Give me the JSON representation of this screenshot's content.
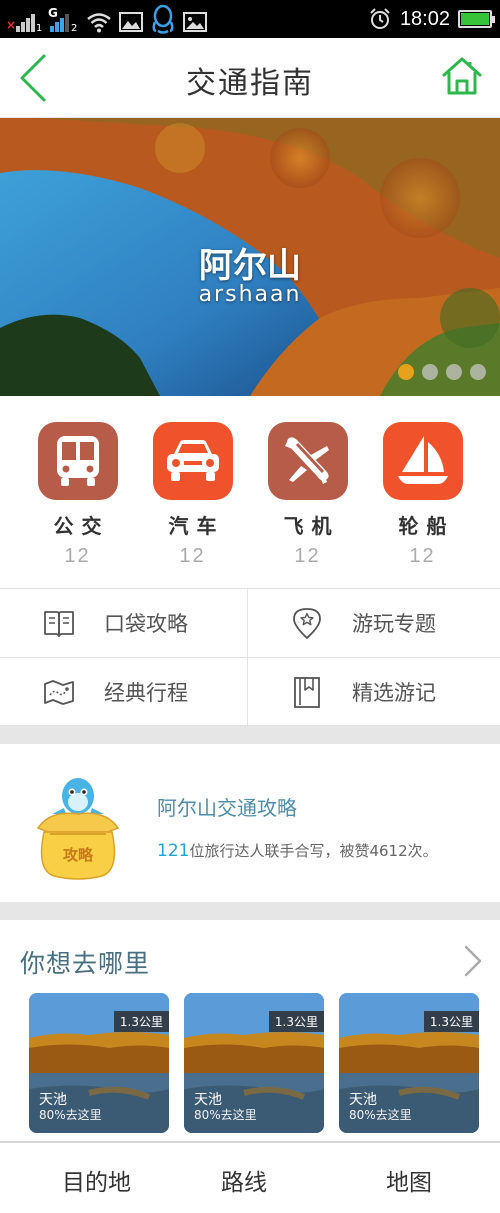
{
  "status_bar": {
    "sim1_label": "1",
    "sim1_mark": "×",
    "sim2_network": "G",
    "sim2_label": "2",
    "time": "18:02",
    "battery_level": 1.0,
    "icons": [
      "signal-icon",
      "wifi-icon",
      "image-icon",
      "qq-icon",
      "gallery-icon",
      "alarm-icon",
      "battery-icon"
    ]
  },
  "header": {
    "title": "交通指南",
    "back_icon": "back-chevron-icon",
    "home_icon": "home-icon",
    "accent_color": "#2db84d"
  },
  "banner": {
    "title": "阿尔山",
    "subtitle": "arshaan",
    "pages": 4,
    "active_page": 1,
    "active_dot_color": "#e7a21c"
  },
  "transport": [
    {
      "label": "公交",
      "count": "12",
      "icon": "bus-icon",
      "color": "#b85c4a"
    },
    {
      "label": "汽车",
      "count": "12",
      "icon": "car-icon",
      "color": "#f0532b"
    },
    {
      "label": "飞机",
      "count": "12",
      "icon": "plane-icon",
      "color": "#b85c4a"
    },
    {
      "label": "轮船",
      "count": "12",
      "icon": "boat-icon",
      "color": "#f0532b"
    }
  ],
  "menu": [
    {
      "label": "口袋攻略",
      "icon": "book-icon"
    },
    {
      "label": "游玩专题",
      "icon": "location-star-icon"
    },
    {
      "label": "经典行程",
      "icon": "map-icon"
    },
    {
      "label": "精选游记",
      "icon": "bookmark-icon"
    }
  ],
  "guide": {
    "title": "阿尔山交通攻略",
    "count": "121",
    "desc_rest": "位旅行达人联手合写，被赞4612次。",
    "mascot_text": "攻略"
  },
  "destinations": {
    "title": "你想去哪里",
    "cards": [
      {
        "distance": "1.3公里",
        "name": "天池",
        "percent": "80%去这里"
      },
      {
        "distance": "1.3公里",
        "name": "天池",
        "percent": "80%去这里"
      },
      {
        "distance": "1.3公里",
        "name": "天池",
        "percent": "80%去这里"
      }
    ]
  },
  "bottom_nav": [
    {
      "label": "目的地"
    },
    {
      "label": "路线"
    },
    {
      "label": "地图"
    }
  ]
}
